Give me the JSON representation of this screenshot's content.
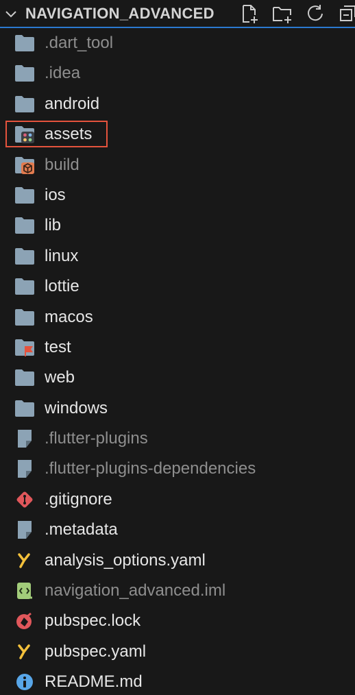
{
  "header": {
    "title": "NAVIGATION_ADVANCED",
    "accent": "#2b79d0"
  },
  "colors": {
    "folder": "#8ca3b5",
    "file": "#8ca3b5",
    "selection_border": "#e5533d",
    "dim_text": "#8e8e8e",
    "text": "#e6e6e6"
  },
  "items": [
    {
      "label": ".dart_tool",
      "icon": "folder-icon",
      "dim": true
    },
    {
      "label": ".idea",
      "icon": "folder-icon",
      "dim": true
    },
    {
      "label": "android",
      "icon": "folder-icon",
      "dim": false
    },
    {
      "label": "assets",
      "icon": "assets-folder-icon",
      "dim": false,
      "highlighted": true
    },
    {
      "label": "build",
      "icon": "build-folder-icon",
      "dim": true
    },
    {
      "label": "ios",
      "icon": "folder-icon",
      "dim": false
    },
    {
      "label": "lib",
      "icon": "folder-icon",
      "dim": false
    },
    {
      "label": "linux",
      "icon": "folder-icon",
      "dim": false
    },
    {
      "label": "lottie",
      "icon": "folder-icon",
      "dim": false
    },
    {
      "label": "macos",
      "icon": "folder-icon",
      "dim": false
    },
    {
      "label": "test",
      "icon": "test-folder-icon",
      "dim": false
    },
    {
      "label": "web",
      "icon": "folder-icon",
      "dim": false
    },
    {
      "label": "windows",
      "icon": "folder-icon",
      "dim": false
    },
    {
      "label": ".flutter-plugins",
      "icon": "file-icon",
      "dim": true
    },
    {
      "label": ".flutter-plugins-dependencies",
      "icon": "file-icon",
      "dim": true
    },
    {
      "label": ".gitignore",
      "icon": "git-icon",
      "dim": false
    },
    {
      "label": ".metadata",
      "icon": "file-icon",
      "dim": false
    },
    {
      "label": "analysis_options.yaml",
      "icon": "yaml-icon",
      "dim": false
    },
    {
      "label": "navigation_advanced.iml",
      "icon": "iml-icon",
      "dim": true
    },
    {
      "label": "pubspec.lock",
      "icon": "lock-icon",
      "dim": false
    },
    {
      "label": "pubspec.yaml",
      "icon": "yaml-icon",
      "dim": false
    },
    {
      "label": "README.md",
      "icon": "info-icon",
      "dim": false
    }
  ]
}
